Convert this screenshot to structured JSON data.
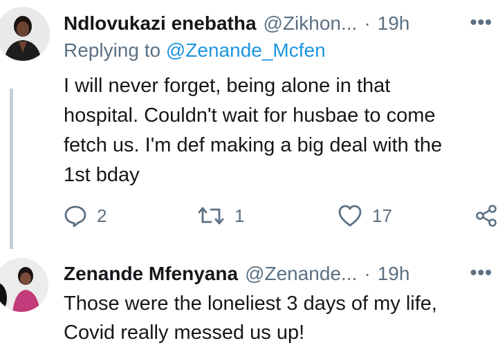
{
  "colors": {
    "text_primary": "#14171a",
    "text_secondary": "#5b7083",
    "link": "#1b95e0",
    "thread_line": "#c4cfd6"
  },
  "tweets": [
    {
      "name": "Ndlovukazi enebatha",
      "handle": "@Zikhon...",
      "separator": "·",
      "time": "19h",
      "more": "•••",
      "replying_prefix": "Replying to",
      "replying_mention": "@Zenande_Mcfen",
      "text_lines": [
        "I will never forget, being alone in that",
        "hospital. Couldn't wait for husbae to come",
        "fetch us. I'm def making a big deal with the",
        "1st bday"
      ],
      "actions": {
        "reply_icon": "reply-icon",
        "reply_count": "2",
        "retweet_icon": "retweet-icon",
        "retweet_count": "1",
        "like_icon": "heart-icon",
        "like_count": "17",
        "share_icon": "share-icon"
      }
    },
    {
      "name": "Zenande Mfenyana",
      "handle": "@Zenande...",
      "separator": "·",
      "time": "19h",
      "more": "•••",
      "text_lines": [
        "Those were the loneliest 3 days of my life,",
        "Covid really messed us up!"
      ]
    }
  ]
}
